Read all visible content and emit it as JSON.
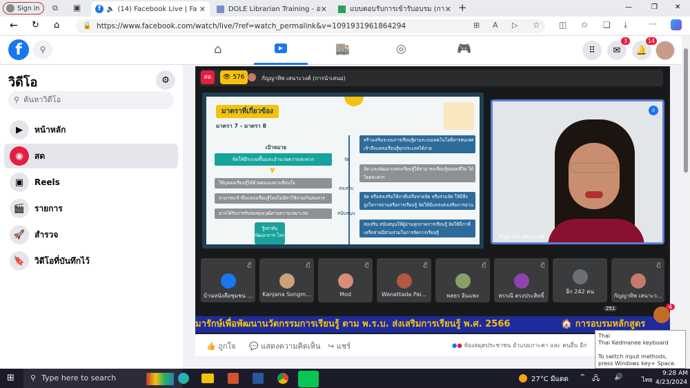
{
  "browser": {
    "signin_label": "Sign in",
    "tabs": [
      {
        "label": "(14) Facebook Live | Facebo",
        "active": true
      },
      {
        "label": "DOLE Librarian Training - อบรมบ",
        "active": false
      },
      {
        "label": "แบบตอบรับการเข้ารับอบรม (การอบรม",
        "active": false
      }
    ],
    "new_tab": "+",
    "url": "https://www.facebook.com/watch/live/?ref=watch_permalink&v=1091931961864294",
    "window_controls": [
      "—",
      "❐",
      "✕"
    ]
  },
  "fb": {
    "logo": "f",
    "messenger_badge": "3",
    "notif_badge": "14"
  },
  "sidebar": {
    "title": "วิดีโอ",
    "search_placeholder": "ค้นหาวิดีโอ",
    "items": [
      {
        "label": "หน้าหลัก",
        "icon": "play-icon"
      },
      {
        "label": "สด",
        "icon": "live-icon"
      },
      {
        "label": "Reels",
        "icon": "reels-icon"
      },
      {
        "label": "รายการ",
        "icon": "clapper-icon"
      },
      {
        "label": "สำรวจ",
        "icon": "rocket-icon"
      },
      {
        "label": "วิดีโอที่บันทึกไว้",
        "icon": "bookmark-icon"
      }
    ]
  },
  "video": {
    "live_badge": "สด",
    "viewers": "576",
    "host_name": "กัญญาทิพ เสนาะวงศ์ (การนำเสนอ)",
    "slide": {
      "title": "มาตราที่เกี่ยวข้อง",
      "subtitle": "มาตรา 7 - มาตรา 8",
      "goal_label": "เป้าหมาย",
      "goal_text": "จัดให้มีระบบขึ้นและอำนวยความสะดวก",
      "left_items": [
        "ให้บุคคลเรียนรู้ได้ด้วยตนเองตามที่สนใจ",
        "สามารถเข้าถึงแหล่งเรียนรู้โดยไม่มีค่าใช้จ่ายเกินสมควร",
        "อาจได้รับการรับรองคุณวุฒิตามความเหมาะสม"
      ],
      "center_labels": [
        "จัด",
        "ส่งเสริม",
        "สนับสนุน"
      ],
      "bottom_text": "รู้เท่าทัน พัฒนาการ โลก",
      "right_items": [
        "สร้างเสริมระบบการเรียนรู้ผ่านระบบเทคโนโลยีสารสนเทศ เข้าถึงแหล่งเรียนรู้ทุกประเภทได้ง่าย",
        "จัด และพัฒนาแหล่งเรียนรู้ให้สามารถเรียนรู้ตลอดชีวิต ได้โดยสะดวก",
        "จัด หรือส่งเสริมให้ภาคีเครือข่ายจัด หรือร่วมจัด ให้มีสิ่งจูงใจการอ่านหรือการเรียนรู้ จัดให้มีแหล่งส่งเสริมการอ่าน",
        "ส่งเสริม สนับสนุนให้ผู้อ่านทุกภาคการเรียนรู้ จัดให้มีภาคีเครือข่ายมีส่วนร่วมในการจัดการเรียนรู้"
      ]
    },
    "speaker_name": "กัญญาทิพ เสนาะวงศ์",
    "participants": [
      {
        "name": "บ้านหนังสือชุมชน ...",
        "color": "#1877f2"
      },
      {
        "name": "Kanjana Songm...",
        "color": "#c9a27a"
      },
      {
        "name": "Mod",
        "color": "#d98c7a"
      },
      {
        "name": "Wanattada Pai...",
        "color": "#b3573f"
      },
      {
        "name": "พสธร อินแพง",
        "color": "#8aa06a"
      },
      {
        "name": "พรรณี ตรงประสิทธิ์",
        "color": "#8e44ad"
      },
      {
        "name": "อีก 242 คน",
        "color": "#6b6f76"
      },
      {
        "name": "กัญญาทิพ เสนาะว...",
        "color": "#c47a6d"
      }
    ],
    "reaction_count": "251",
    "ticker": "มารักษ์เพื่อพัฒนานวัตกรรมการเรียนรู้ ตาม พ.ร.บ. ส่งเสริมการเรียนรู้ พ.ศ. 2566",
    "ticker_right": "🏠 การอบรมหลักสูตร",
    "corner_badge": "4"
  },
  "actions": {
    "like": "ถูกใจ",
    "comment": "แสดงความคิดเห็น",
    "share": "แชร์",
    "reactors": "ห้องสมุดประชาชน อำเภอเกาะคา และ คนอื่น อีก"
  },
  "ime_tooltip": {
    "line1": "Thai",
    "line2": "Thai Kedmanee keyboard",
    "line3": "To switch input methods, press Windows key+ Space."
  },
  "taskbar": {
    "search_placeholder": "Type here to search",
    "weather": "27°C มีแดด",
    "lang": "ไทย",
    "time": "9:28 AM",
    "date": "4/23/2024"
  }
}
